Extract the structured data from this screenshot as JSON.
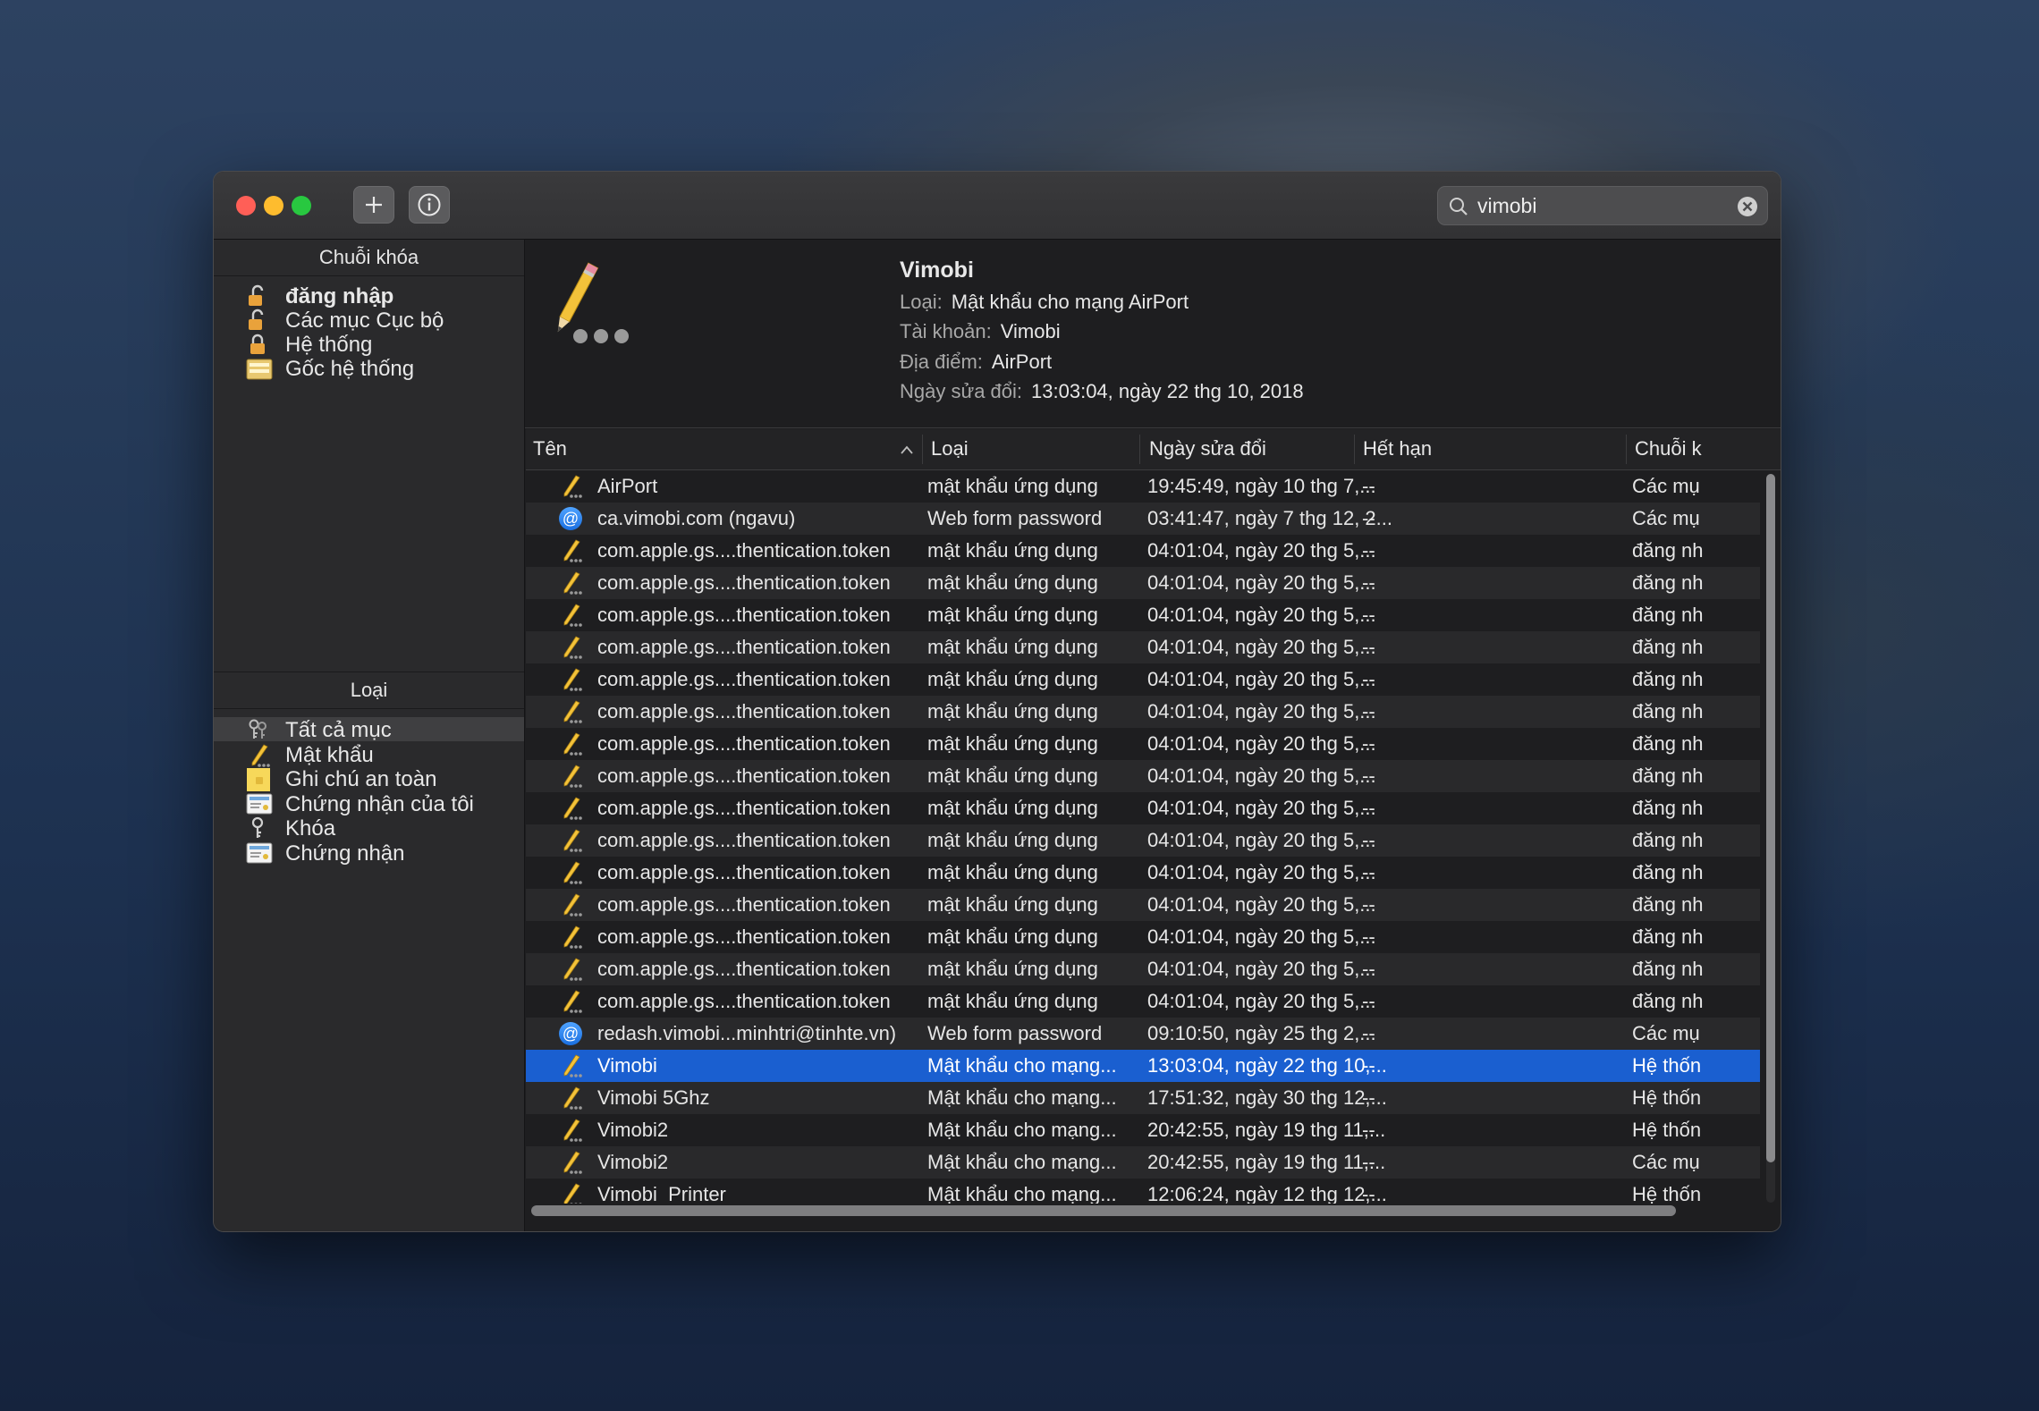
{
  "search": {
    "value": "vimobi"
  },
  "sidebar": {
    "keychains_header": "Chuỗi khóa",
    "keychains": [
      {
        "label": "đăng nhập",
        "icon": "lock-open-icon",
        "bold": true
      },
      {
        "label": "Các mục Cục bộ",
        "icon": "lock-open-icon"
      },
      {
        "label": "Hệ thống",
        "icon": "lock-icon"
      },
      {
        "label": "Gốc hệ thống",
        "icon": "cabinet-icon"
      }
    ],
    "categories_header": "Loại",
    "categories": [
      {
        "label": "Tất cả mục",
        "icon": "keys-icon",
        "selected": true
      },
      {
        "label": "Mật khẩu",
        "icon": "pencil-icon"
      },
      {
        "label": "Ghi chú an toàn",
        "icon": "note-icon"
      },
      {
        "label": "Chứng nhận của tôi",
        "icon": "certificate-icon"
      },
      {
        "label": "Khóa",
        "icon": "key-icon"
      },
      {
        "label": "Chứng nhận",
        "icon": "certificate-icon"
      }
    ]
  },
  "detail": {
    "title": "Vimobi",
    "type_key": "Loại:",
    "type_value": "Mật khẩu cho mạng AirPort",
    "account_key": "Tài khoản:",
    "account_value": "Vimobi",
    "location_key": "Địa điểm:",
    "location_value": "AirPort",
    "modified_key": "Ngày sửa đổi:",
    "modified_value": "13:03:04, ngày 22 thg 10, 2018"
  },
  "table": {
    "columns": [
      "Tên",
      "Loại",
      "Ngày sửa đổi",
      "Hết hạn",
      "Chuỗi k"
    ],
    "rows": [
      {
        "icon": "pencil",
        "name": "AirPort",
        "type": "mật khẩu ứng dụng",
        "date": "19:45:49, ngày 10 thg 7,...",
        "expires": "--",
        "keychain": "Các mụ"
      },
      {
        "icon": "at",
        "name": "ca.vimobi.com (ngavu)",
        "type": "Web form password",
        "date": "03:41:47, ngày 7 thg 12, 2...",
        "expires": "--",
        "keychain": "Các mụ"
      },
      {
        "icon": "pencil",
        "name": "com.apple.gs....thentication.token",
        "type": "mật khẩu ứng dụng",
        "date": "04:01:04, ngày 20 thg 5,...",
        "expires": "--",
        "keychain": "đăng nh"
      },
      {
        "icon": "pencil",
        "name": "com.apple.gs....thentication.token",
        "type": "mật khẩu ứng dụng",
        "date": "04:01:04, ngày 20 thg 5,...",
        "expires": "--",
        "keychain": "đăng nh"
      },
      {
        "icon": "pencil",
        "name": "com.apple.gs....thentication.token",
        "type": "mật khẩu ứng dụng",
        "date": "04:01:04, ngày 20 thg 5,...",
        "expires": "--",
        "keychain": "đăng nh"
      },
      {
        "icon": "pencil",
        "name": "com.apple.gs....thentication.token",
        "type": "mật khẩu ứng dụng",
        "date": "04:01:04, ngày 20 thg 5,...",
        "expires": "--",
        "keychain": "đăng nh"
      },
      {
        "icon": "pencil",
        "name": "com.apple.gs....thentication.token",
        "type": "mật khẩu ứng dụng",
        "date": "04:01:04, ngày 20 thg 5,...",
        "expires": "--",
        "keychain": "đăng nh"
      },
      {
        "icon": "pencil",
        "name": "com.apple.gs....thentication.token",
        "type": "mật khẩu ứng dụng",
        "date": "04:01:04, ngày 20 thg 5,...",
        "expires": "--",
        "keychain": "đăng nh"
      },
      {
        "icon": "pencil",
        "name": "com.apple.gs....thentication.token",
        "type": "mật khẩu ứng dụng",
        "date": "04:01:04, ngày 20 thg 5,...",
        "expires": "--",
        "keychain": "đăng nh"
      },
      {
        "icon": "pencil",
        "name": "com.apple.gs....thentication.token",
        "type": "mật khẩu ứng dụng",
        "date": "04:01:04, ngày 20 thg 5,...",
        "expires": "--",
        "keychain": "đăng nh"
      },
      {
        "icon": "pencil",
        "name": "com.apple.gs....thentication.token",
        "type": "mật khẩu ứng dụng",
        "date": "04:01:04, ngày 20 thg 5,...",
        "expires": "--",
        "keychain": "đăng nh"
      },
      {
        "icon": "pencil",
        "name": "com.apple.gs....thentication.token",
        "type": "mật khẩu ứng dụng",
        "date": "04:01:04, ngày 20 thg 5,...",
        "expires": "--",
        "keychain": "đăng nh"
      },
      {
        "icon": "pencil",
        "name": "com.apple.gs....thentication.token",
        "type": "mật khẩu ứng dụng",
        "date": "04:01:04, ngày 20 thg 5,...",
        "expires": "--",
        "keychain": "đăng nh"
      },
      {
        "icon": "pencil",
        "name": "com.apple.gs....thentication.token",
        "type": "mật khẩu ứng dụng",
        "date": "04:01:04, ngày 20 thg 5,...",
        "expires": "--",
        "keychain": "đăng nh"
      },
      {
        "icon": "pencil",
        "name": "com.apple.gs....thentication.token",
        "type": "mật khẩu ứng dụng",
        "date": "04:01:04, ngày 20 thg 5,...",
        "expires": "--",
        "keychain": "đăng nh"
      },
      {
        "icon": "pencil",
        "name": "com.apple.gs....thentication.token",
        "type": "mật khẩu ứng dụng",
        "date": "04:01:04, ngày 20 thg 5,...",
        "expires": "--",
        "keychain": "đăng nh"
      },
      {
        "icon": "pencil",
        "name": "com.apple.gs....thentication.token",
        "type": "mật khẩu ứng dụng",
        "date": "04:01:04, ngày 20 thg 5,...",
        "expires": "--",
        "keychain": "đăng nh"
      },
      {
        "icon": "at",
        "name": "redash.vimobi...minhtri@tinhte.vn)",
        "type": "Web form password",
        "date": "09:10:50, ngày 25 thg 2,...",
        "expires": "--",
        "keychain": "Các mụ"
      },
      {
        "icon": "pencil",
        "name": "Vimobi",
        "type": "Mật khẩu cho mạng...",
        "date": "13:03:04, ngày 22 thg 10,...",
        "expires": "--",
        "keychain": "Hệ thốn",
        "selected": true
      },
      {
        "icon": "pencil",
        "name": "Vimobi 5Ghz",
        "type": "Mật khẩu cho mạng...",
        "date": "17:51:32, ngày 30 thg 12,...",
        "expires": "--",
        "keychain": "Hệ thốn"
      },
      {
        "icon": "pencil",
        "name": "Vimobi2",
        "type": "Mật khẩu cho mạng...",
        "date": "20:42:55, ngày 19 thg 11,...",
        "expires": "--",
        "keychain": "Hệ thốn"
      },
      {
        "icon": "pencil",
        "name": "Vimobi2",
        "type": "Mật khẩu cho mạng...",
        "date": "20:42:55, ngày 19 thg 11,...",
        "expires": "--",
        "keychain": "Các mụ"
      },
      {
        "icon": "pencil",
        "name": "Vimobi_Printer",
        "type": "Mật khẩu cho mạng...",
        "date": "12:06:24, ngày 12 thg 12,...",
        "expires": "--",
        "keychain": "Hệ thốn"
      }
    ]
  },
  "colors": {
    "selection": "#1a5fd0",
    "close": "#ff5f57",
    "minimize": "#febc2e",
    "zoom": "#28c840"
  }
}
